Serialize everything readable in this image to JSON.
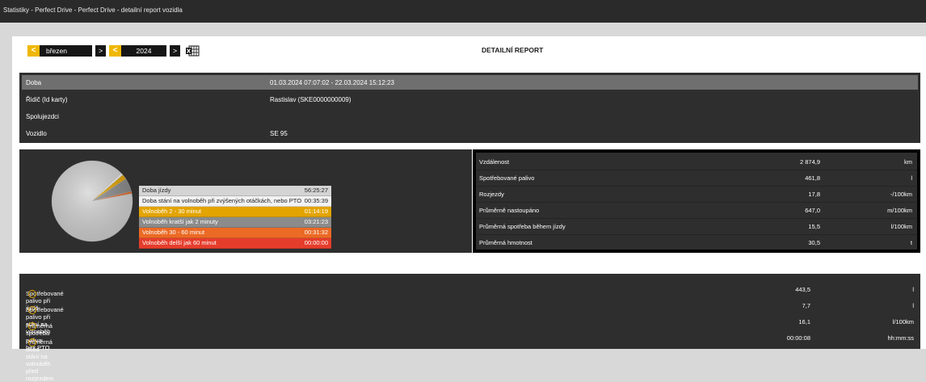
{
  "window": {
    "title": "Statistiky - Perfect Drive - Perfect Drive - detailní report vozidla"
  },
  "nav": {
    "month": "březen",
    "year": "2024",
    "prev_glyph": "<",
    "next_glyph": ">",
    "export_icon": "excel-icon"
  },
  "report": {
    "title": "DETAILNÍ REPORT"
  },
  "info": {
    "rows": [
      {
        "label": "Doba",
        "value": "01.03.2024 07:07:02 - 22.03.2024 15:12:23"
      },
      {
        "label": "Řidič (Id karty)",
        "value": "Rastislav (SKE0000000009)"
      },
      {
        "label": "Spolujezdci",
        "value": ""
      },
      {
        "label": "Vozidlo",
        "value": "SE 95"
      }
    ]
  },
  "chart_data": {
    "type": "pie",
    "categories": [
      "Doba jízdy",
      "Doba stání na volnoběh při zvýšených otáčkách, nebo PTO",
      "Volnoběh 2 - 30 minut",
      "Volnoběh kratší jak 2 minuty",
      "Volnoběh 30 - 60 minut",
      "Volnoběh delší jak 60 minut"
    ],
    "durations": [
      "56:25:27",
      "00:35:39",
      "01:14:19",
      "03:21:23",
      "00:31:32",
      "00:00:00"
    ],
    "values": [
      203127,
      2139,
      4459,
      12083,
      1892,
      0
    ],
    "colors": [
      "#d4d4d4",
      "#f2f2f2",
      "#e3a400",
      "#8b8b8b",
      "#eb6a25",
      "#e53d2c"
    ],
    "text_colors": [
      "#222222",
      "#222222",
      "#ffffff",
      "#ffffff",
      "#ffffff",
      "#ffffff"
    ]
  },
  "stats": {
    "rows": [
      {
        "label": "Vzdálenost",
        "value": "2 874,9",
        "unit": "km"
      },
      {
        "label": "Spotřebované palivo",
        "value": "461,8",
        "unit": "l"
      },
      {
        "label": "Rozjezdy",
        "value": "17,8",
        "unit": "-/100km"
      },
      {
        "label": "Průměrně nastoupáno",
        "value": "647,0",
        "unit": "m/100km"
      },
      {
        "label": "Průměrná spotřeba během jízdy",
        "value": "15,5",
        "unit": "l/100km"
      },
      {
        "label": "Průměrná hmotnost",
        "value": "30,5",
        "unit": "t"
      }
    ]
  },
  "fuel": {
    "rows": [
      {
        "label": "Spotřebované palivo při jízdě",
        "value": "443,5",
        "unit": "l"
      },
      {
        "label": "Spotřebované palivo při stání na volnoběh",
        "value": "7,7",
        "unit": "l"
      },
      {
        "label": "Průměrná spotřeba paliva bez PTO",
        "value": "16,1",
        "unit": "l/100km"
      },
      {
        "label": "Průměrná doba stání na volnoběh před rozjezdem",
        "value": "00:00:08",
        "unit": "hh:mm:ss"
      }
    ],
    "info_glyph": "i"
  }
}
